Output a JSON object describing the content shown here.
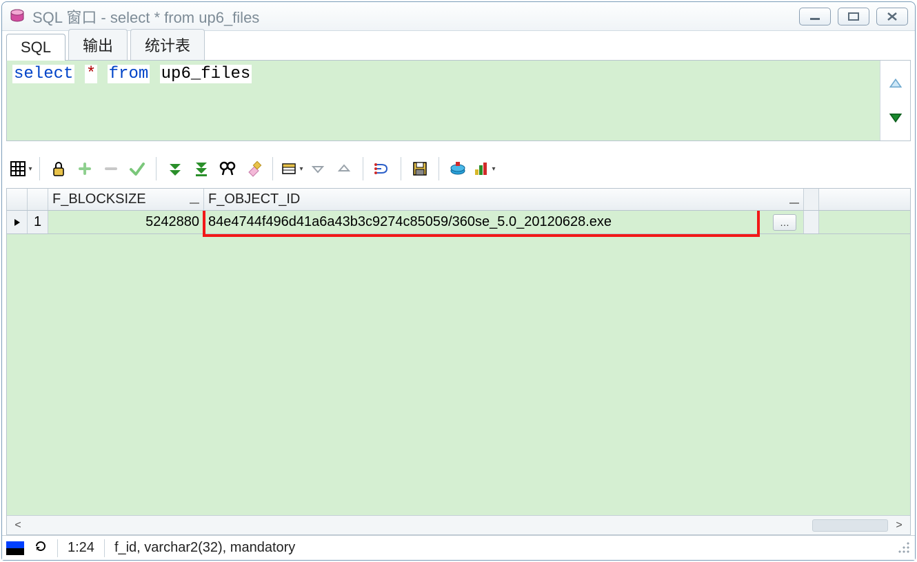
{
  "window": {
    "title": "SQL 窗口 - select * from up6_files"
  },
  "tabs": {
    "sql": "SQL",
    "output": "输出",
    "stats": "统计表"
  },
  "sql": {
    "tok_select": "select",
    "tok_star": "*",
    "tok_from": "from",
    "tok_ident": "up6_files"
  },
  "columns": {
    "blocksize": "F_BLOCKSIZE",
    "objectid": "F_OBJECT_ID"
  },
  "rows": [
    {
      "n": "1",
      "blocksize": "5242880",
      "objectid": "84e4744f496d41a6a43b3c9274c85059/360se_5.0_20120628.exe"
    }
  ],
  "status": {
    "pos": "1:24",
    "field": "f_id, varchar2(32), mandatory"
  }
}
